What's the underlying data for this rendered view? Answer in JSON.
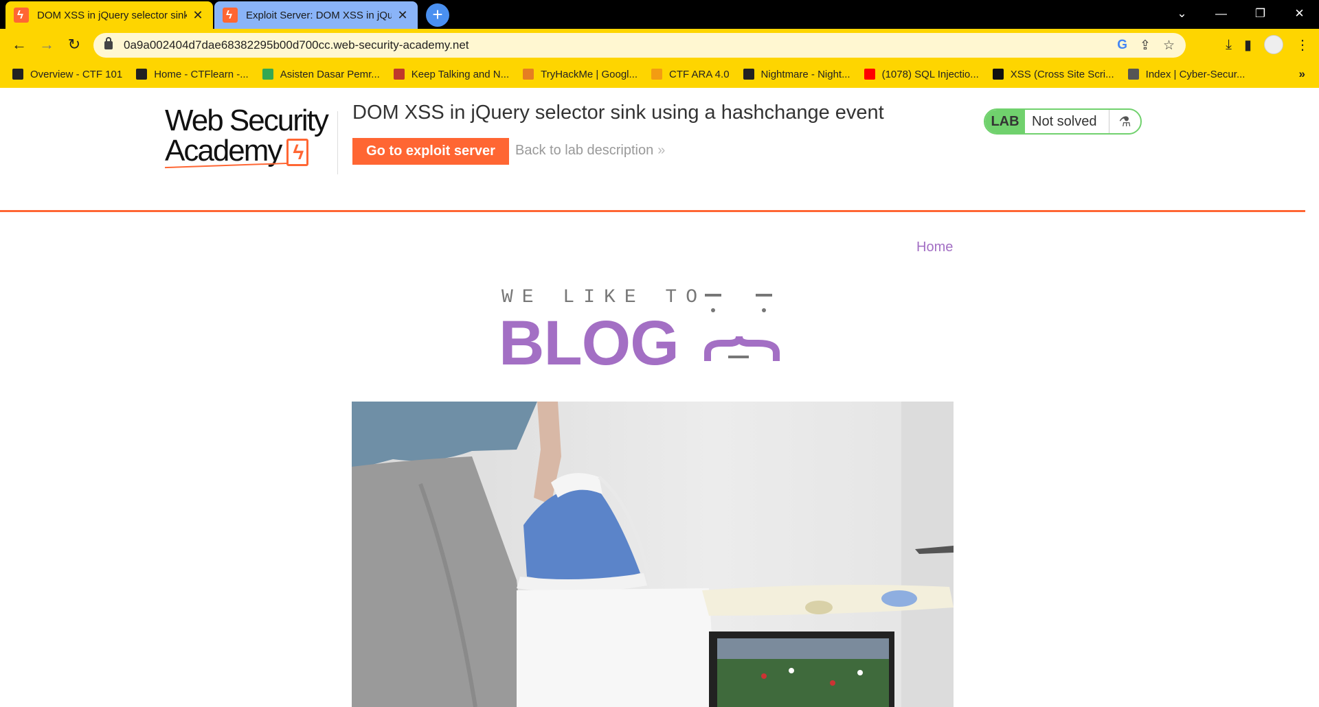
{
  "browser": {
    "tabs": [
      {
        "title": "DOM XSS in jQuery selector sink",
        "active": true
      },
      {
        "title": "Exploit Server: DOM XSS in jQuer",
        "active": false
      }
    ],
    "url": "0a9a002404d7dae68382295b00d700cc.web-security-academy.net",
    "bookmarks": [
      {
        "label": "Overview - CTF 101",
        "icon": "book-icon",
        "color": "#222222"
      },
      {
        "label": "Home - CTFlearn -...",
        "icon": "ctf-icon",
        "color": "#222222"
      },
      {
        "label": "Asisten Dasar Pemr...",
        "icon": "drive-icon",
        "color": "#34a853"
      },
      {
        "label": "Keep Talking and N...",
        "icon": "bomb-icon",
        "color": "#c0392b"
      },
      {
        "label": "TryHackMe | Googl...",
        "icon": "cloud-icon",
        "color": "#e67e22"
      },
      {
        "label": "CTF ARA 4.0",
        "icon": "pin-icon",
        "color": "#f39c12"
      },
      {
        "label": "Nightmare - Night...",
        "icon": "notebook-icon",
        "color": "#222222"
      },
      {
        "label": "(1078) SQL Injectio...",
        "icon": "youtube-icon",
        "color": "#ff0000"
      },
      {
        "label": "XSS (Cross Site Scri...",
        "icon": "phone-icon",
        "color": "#111111"
      },
      {
        "label": "Index | Cyber-Secur...",
        "icon": "globe-icon",
        "color": "#555555"
      }
    ],
    "bookmarks_overflow": "»"
  },
  "header": {
    "logo_line1": "Web Security",
    "logo_line2": "Academy",
    "lab_title": "DOM XSS in jQuery selector sink using a hashchange event",
    "exploit_button": "Go to exploit server",
    "back_link": "Back to lab description",
    "back_chevron": "»",
    "lab_badge": "LAB",
    "status": "Not solved"
  },
  "nav": {
    "home": "Home"
  },
  "banner": {
    "tagline": "WE LIKE TO",
    "word": "BLOG"
  },
  "colors": {
    "chrome_yellow": "#fed500",
    "accent_orange": "#ff6633",
    "blog_purple": "#a36fc4",
    "lab_green": "#70d16d"
  }
}
